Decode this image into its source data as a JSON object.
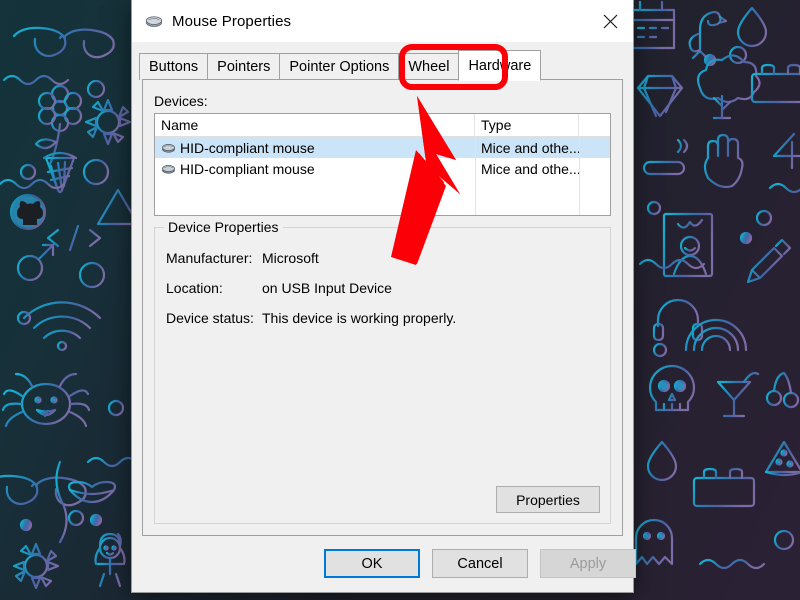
{
  "desktop": {
    "wallpaper_description": "dark doodle-pattern wallpaper with teal-to-purple gradient line art",
    "colors": {
      "base": "#1b1e22",
      "doodle_left": "#1aa3c4",
      "doodle_right": "#6f6aa8"
    }
  },
  "dialog": {
    "title": "Mouse Properties",
    "title_icon": "mouse-icon",
    "close_label": "Close",
    "close_icon": "close-icon",
    "tabs": [
      {
        "label": "Buttons",
        "selected": false
      },
      {
        "label": "Pointers",
        "selected": false
      },
      {
        "label": "Pointer Options",
        "selected": false
      },
      {
        "label": "Wheel",
        "selected": false
      },
      {
        "label": "Hardware",
        "selected": true
      }
    ],
    "hardware_tab": {
      "devices_label": "Devices:",
      "columns": [
        "Name",
        "Type",
        ""
      ],
      "rows": [
        {
          "name": "HID-compliant mouse",
          "type": "Mice and othe...",
          "icon": "mouse-icon",
          "selected": true
        },
        {
          "name": "HID-compliant mouse",
          "type": "Mice and othe...",
          "icon": "mouse-icon",
          "selected": false
        }
      ],
      "group": {
        "title": "Device Properties",
        "properties": [
          {
            "label": "Manufacturer:",
            "value": "Microsoft"
          },
          {
            "label": "Location:",
            "value": "on USB Input Device"
          },
          {
            "label": "Device status:",
            "value": "This device is working properly."
          }
        ],
        "properties_button": "Properties"
      }
    },
    "footer": {
      "ok": "OK",
      "cancel": "Cancel",
      "apply": "Apply",
      "apply_disabled": true
    }
  },
  "annotations": {
    "highlight_color": "#fb0007",
    "highlight_target": "Hardware",
    "arrow_target": "Hardware tab",
    "arrow_direction": "up-left"
  }
}
